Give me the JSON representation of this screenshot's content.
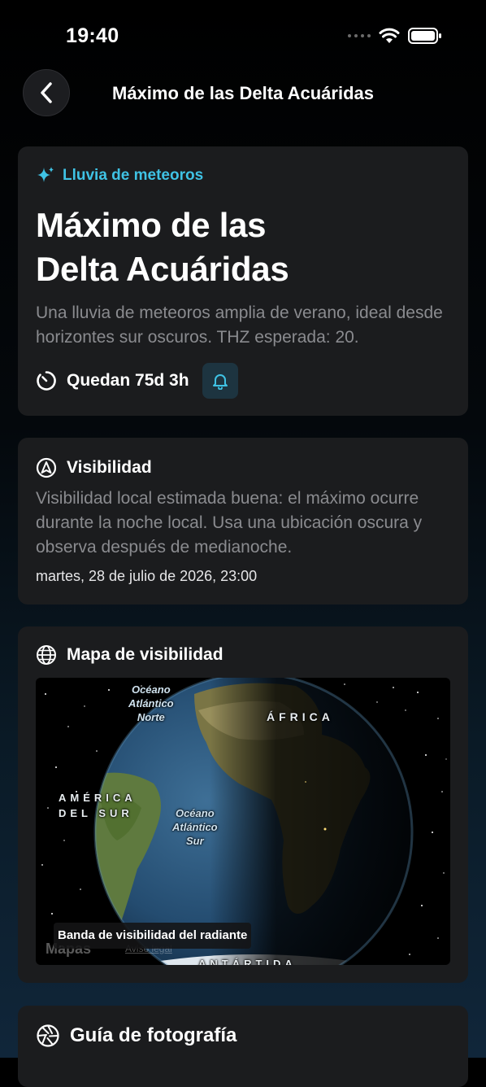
{
  "status_bar": {
    "time": "19:40"
  },
  "nav": {
    "title": "Máximo de las Delta Acuáridas"
  },
  "event": {
    "category": "Lluvia de meteoros",
    "title_line1": "Máximo de las",
    "title_line2": "Delta Acuáridas",
    "description": "Una lluvia de meteoros amplia de verano, ideal desde horizontes sur oscuros. THZ esperada: 20.",
    "countdown": "Quedan 75d 3h"
  },
  "visibility": {
    "heading": "Visibilidad",
    "text": "Visibilidad local estimada buena: el máximo ocurre durante la noche local. Usa una ubicación oscura y observa después de medianoche.",
    "datetime": "martes, 28 de julio de 2026, 23:00"
  },
  "map_section": {
    "heading": "Mapa de visibilidad",
    "labels": {
      "north_atlantic": [
        "Océano",
        "Atlántico",
        "Norte"
      ],
      "africa": "ÁFRICA",
      "south_america": [
        "AMÉRICA",
        "DEL SUR"
      ],
      "south_atlantic": [
        "Océano",
        "Atlántico",
        "Sur"
      ],
      "antarctica": "ANTÁRTIDA"
    },
    "caption": "Banda de visibilidad del radiante",
    "brand": "Mapas",
    "legal": "Aviso legal"
  },
  "photo_guide": {
    "heading": "Guía de fotografía"
  },
  "colors": {
    "accent": "#3fc2e4",
    "card": "#1b1c1e",
    "muted_text": "#8a8b8f"
  }
}
